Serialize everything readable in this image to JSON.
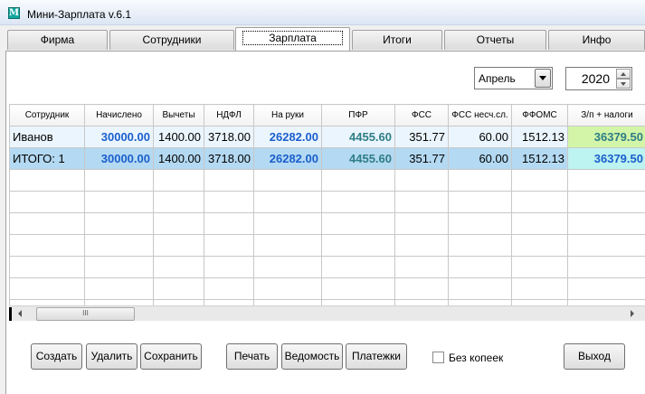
{
  "window": {
    "title": "Мини-Зарплата v.6.1",
    "icon_letter": "M"
  },
  "tabs": [
    {
      "label": "Фирма"
    },
    {
      "label": "Сотрудники"
    },
    {
      "label": "Зарплата",
      "active": true
    },
    {
      "label": "Итоги"
    },
    {
      "label": "Отчеты"
    },
    {
      "label": "Инфо"
    }
  ],
  "period": {
    "month": "Апрель",
    "year": "2020"
  },
  "table": {
    "columns": [
      "Сотрудник",
      "Начислено",
      "Вычеты",
      "НДФЛ",
      "На руки",
      "ПФР",
      "ФСС",
      "ФСС несч.сл.",
      "ФФОМС",
      "З/п + налоги"
    ],
    "rows": [
      [
        "Иванов",
        "30000.00",
        "1400.00",
        "3718.00",
        "26282.00",
        "4455.60",
        "351.77",
        "60.00",
        "1512.13",
        "36379.50"
      ],
      [
        "ИТОГО: 1",
        "30000.00",
        "1400.00",
        "3718.00",
        "26282.00",
        "4455.60",
        "351.77",
        "60.00",
        "1512.13",
        "36379.50"
      ]
    ]
  },
  "scrollbar": {
    "thumb_grip": "III"
  },
  "buttons": {
    "create": "Создать",
    "delete": "Удалить",
    "save": "Сохранить",
    "print": "Печать",
    "statement": "Ведомость",
    "payments": "Платежки",
    "exit": "Выход"
  },
  "no_kopecks": {
    "label": "Без копеек",
    "checked": false
  },
  "colors": {
    "accent_blue": "#1a5fcc",
    "teal": "#2e7d86",
    "total_row": "#b4d9f2",
    "highlight_green": "#d2f5a8"
  }
}
